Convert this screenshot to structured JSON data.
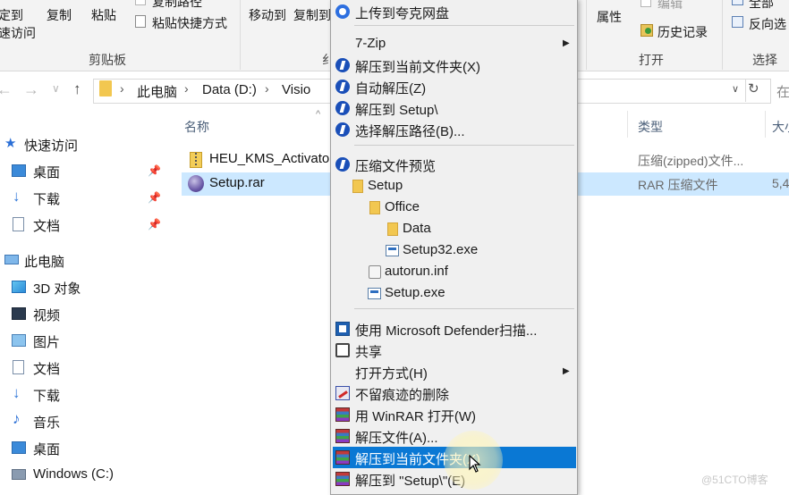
{
  "ribbon": {
    "clipboard": {
      "pin_label_line1": "定到",
      "pin_label_line2": "速访问",
      "copy": "复制",
      "paste": "粘贴",
      "copy_path": "复制路径",
      "paste_shortcut": "粘贴快捷方式",
      "group": "剪贴板"
    },
    "organize": {
      "move_to": "移动到",
      "copy_to": "复制到",
      "group_partial": "纟"
    },
    "open": {
      "properties": "属性",
      "edit": "编辑",
      "history": "历史记录",
      "group": "打开"
    },
    "select": {
      "select_all": "全部",
      "invert": "反向选",
      "group": "选择"
    }
  },
  "address": {
    "breadcrumbs": [
      "此电脑",
      "Data (D:)",
      "Visio"
    ],
    "separator": "›",
    "refresh_icon": "refresh-icon",
    "search_partial": "在"
  },
  "sidebar": {
    "items": [
      {
        "label": "快速访问",
        "icon": "star-icon",
        "level": "top",
        "pinned": false
      },
      {
        "label": "桌面",
        "icon": "desktop-icon",
        "level": "child",
        "pinned": true
      },
      {
        "label": "下载",
        "icon": "download-icon",
        "level": "child",
        "pinned": true
      },
      {
        "label": "文档",
        "icon": "document-icon",
        "level": "child",
        "pinned": true
      },
      {
        "label": "此电脑",
        "icon": "computer-icon",
        "level": "top",
        "pinned": false
      },
      {
        "label": "3D 对象",
        "icon": "3d-objects-icon",
        "level": "child",
        "pinned": false
      },
      {
        "label": "视频",
        "icon": "video-icon",
        "level": "child",
        "pinned": false
      },
      {
        "label": "图片",
        "icon": "pictures-icon",
        "level": "child",
        "pinned": false
      },
      {
        "label": "文档",
        "icon": "document-icon",
        "level": "child",
        "pinned": false
      },
      {
        "label": "下载",
        "icon": "download-icon",
        "level": "child",
        "pinned": false
      },
      {
        "label": "音乐",
        "icon": "music-icon",
        "level": "child",
        "pinned": false
      },
      {
        "label": "桌面",
        "icon": "desktop-icon",
        "level": "child",
        "pinned": false
      },
      {
        "label": "Windows (C:)",
        "icon": "drive-icon",
        "level": "child",
        "pinned": false
      }
    ]
  },
  "filelist": {
    "columns": {
      "name": "名称",
      "type": "类型",
      "size_partial": "大小"
    },
    "rows": [
      {
        "name": "HEU_KMS_Activator",
        "type": "压缩(zipped)文件...",
        "size": "",
        "icon": "zip-folder-icon",
        "selected": false
      },
      {
        "name": "Setup.rar",
        "type": "RAR 压缩文件",
        "size": "5,4",
        "icon": "rar-archive-icon",
        "selected": true
      }
    ]
  },
  "context_menu": {
    "items": {
      "upload_kuake": "上传到夸克网盘",
      "seven_zip": "7-Zip",
      "bz_extract_here": "解压到当前文件夹(X)",
      "bz_auto_extract": "自动解压(Z)",
      "bz_extract_to_setup": "解压到 Setup\\",
      "bz_choose_path": "选择解压路径(B)...",
      "preview": "压缩文件预览",
      "defender": "使用 Microsoft Defender扫描...",
      "share": "共享",
      "open_with": "打开方式(H)",
      "erase": "不留痕迹的删除",
      "open_winrar": "用 WinRAR 打开(W)",
      "extract_files": "解压文件(A)...",
      "extract_here_winrar": "解压到当前文件夹(X)",
      "extract_to_setup_winrar": "解压到 \"Setup\\\"(E)"
    },
    "tree": {
      "setup": "Setup",
      "office": "Office",
      "data": "Data",
      "setup32": "Setup32.exe",
      "autorun": "autorun.inf",
      "setup_exe": "Setup.exe"
    }
  },
  "watermark": "@51CTO博客",
  "colors": {
    "menu_highlight": "#0a78d4",
    "selection_row": "#cce8ff",
    "ribbon_bg": "#f3f3f3",
    "menu_bg": "#f0f0f0"
  }
}
